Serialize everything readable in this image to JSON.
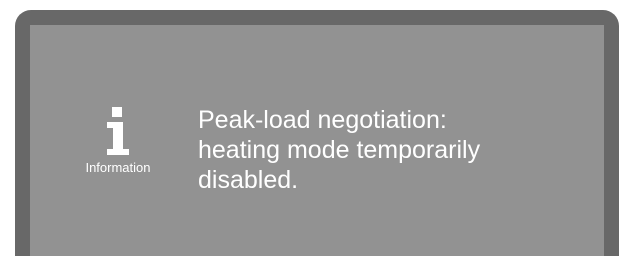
{
  "dialog": {
    "icon": "information-icon",
    "icon_label": "Information",
    "message_lines": [
      "Peak-load negotiation:",
      "heating mode temporarily",
      "disabled."
    ]
  },
  "colors": {
    "frame": "#686868",
    "panel": "#929292",
    "text": "#ffffff"
  }
}
